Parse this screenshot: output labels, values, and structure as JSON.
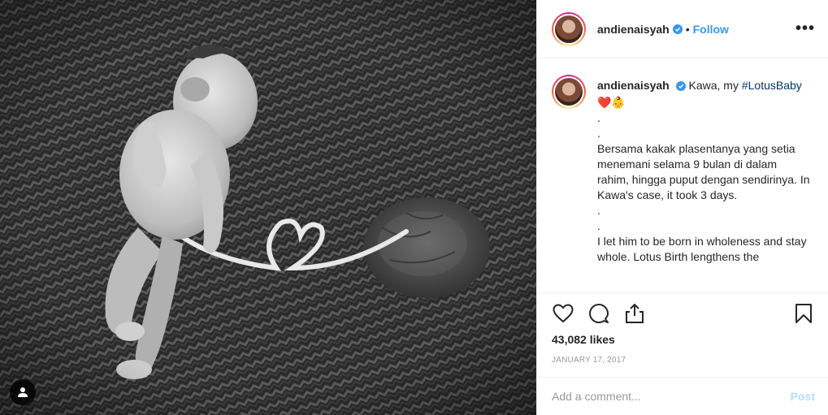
{
  "post": {
    "username": "andienaisyah",
    "follow_label": "Follow",
    "separator": "•",
    "more_label": "•••",
    "caption": {
      "lead": "Kawa, my ",
      "hashtag": "#LotusBaby",
      "emojis": "❤️👶",
      "lines": [
        ".",
        ".",
        "Bersama kakak plasentanya yang setia menemani selama 9 bulan di dalam rahim, hingga puput dengan sendirinya. In Kawa's case, it took 3 days.",
        ".",
        ".",
        "I let him to be born in wholeness and stay whole. Lotus Birth lengthens the"
      ]
    },
    "likes": "43,082 likes",
    "date": "JANUARY 17, 2017",
    "comment_placeholder": "Add a comment...",
    "post_label": "Post"
  },
  "icons": {
    "like": "heart-icon",
    "comment": "comment-icon",
    "share": "share-icon",
    "save": "bookmark-icon",
    "verified": "verified-badge-icon",
    "tagged": "user-tag-icon"
  },
  "colors": {
    "accent": "#3897f0",
    "hashtag": "#003569",
    "post_disabled": "#b2dffc",
    "muted": "#999999"
  }
}
